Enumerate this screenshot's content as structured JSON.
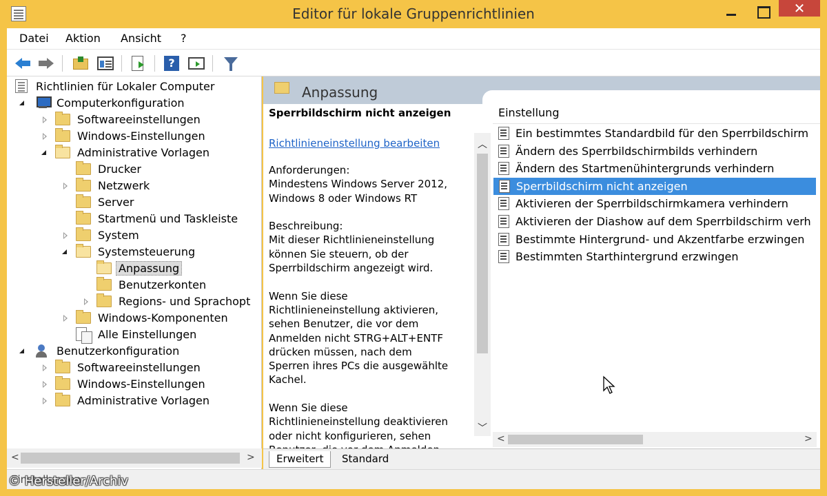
{
  "window": {
    "title": "Editor für lokale Gruppenrichtlinien",
    "close_glyph": "✕"
  },
  "menu": [
    "Datei",
    "Aktion",
    "Ansicht",
    "?"
  ],
  "toolbar": {
    "icons": [
      "back-arrow-icon",
      "forward-arrow-icon",
      "folder-up-icon",
      "show-hide-tree-icon",
      "export-list-icon",
      "help-icon",
      "properties-icon",
      "filter-icon"
    ],
    "help_glyph": "?"
  },
  "tree": {
    "root": "Richtlinien für Lokaler Computer",
    "items": [
      {
        "label": "Computerkonfiguration"
      },
      {
        "label": "Softwareeinstellungen"
      },
      {
        "label": "Windows-Einstellungen"
      },
      {
        "label": "Administrative Vorlagen"
      },
      {
        "label": "Drucker"
      },
      {
        "label": "Netzwerk"
      },
      {
        "label": "Server"
      },
      {
        "label": "Startmenü und Taskleiste"
      },
      {
        "label": "System"
      },
      {
        "label": "Systemsteuerung"
      },
      {
        "label": "Anpassung"
      },
      {
        "label": "Benutzerkonten"
      },
      {
        "label": "Regions- und Sprachopt"
      },
      {
        "label": "Windows-Komponenten"
      },
      {
        "label": "Alle Einstellungen"
      },
      {
        "label": "Benutzerkonfiguration"
      },
      {
        "label": "Softwareeinstellungen"
      },
      {
        "label": "Windows-Einstellungen"
      },
      {
        "label": "Administrative Vorlagen"
      }
    ],
    "selected": "Anpassung"
  },
  "header": {
    "title": "Anpassung"
  },
  "description": {
    "title": "Sperrbildschirm nicht anzeigen",
    "link": "Richtlinieneinstellung bearbeiten",
    "text": "Anforderungen:\nMindestens Windows Server 2012,\nWindows 8 oder Windows RT\n\nBeschreibung:\nMit dieser Richtlinieneinstellung\nkönnen Sie steuern, ob der\nSperrbildschirm angezeigt wird.\n\nWenn Sie diese\nRichtlinieneinstellung aktivieren,\nsehen Benutzer, die vor dem\nAnmelden nicht STRG+ALT+ENTF\ndrücken müssen, nach dem\nSperren ihres PCs die ausgewählte\nKachel.\n\nWenn Sie diese\nRichtlinieneinstellung deaktivieren\noder nicht konfigurieren, sehen\nBenutzer, die vor dem Anmelden"
  },
  "list": {
    "column": "Einstellung",
    "rows": [
      "Ein bestimmtes Standardbild für den Sperrbildschirm",
      "Ändern des Sperrbildschirmbilds verhindern",
      "Ändern des Startmenühintergrunds verhindern",
      "Sperrbildschirm nicht anzeigen",
      "Aktivieren der Sperrbildschirmkamera verhindern",
      "Aktivieren der Diashow auf dem Sperrbildschirm verh",
      "Bestimmte Hintergrund- und Akzentfarbe erzwingen",
      "Bestimmten Starthintergrund erzwingen"
    ],
    "selected_index": 3
  },
  "tabs": [
    "Erweitert",
    "Standard"
  ],
  "status": {
    "text": "Einstellungen"
  },
  "watermark": "© Hersteller/Archiv",
  "scroll": {
    "left": "<",
    "right": ">",
    "up": "︿",
    "down": "﹀"
  },
  "colors": {
    "titlebar": "#f5c447",
    "selection": "#3b8dde",
    "link": "#1d62c7",
    "close": "#c7463b"
  }
}
